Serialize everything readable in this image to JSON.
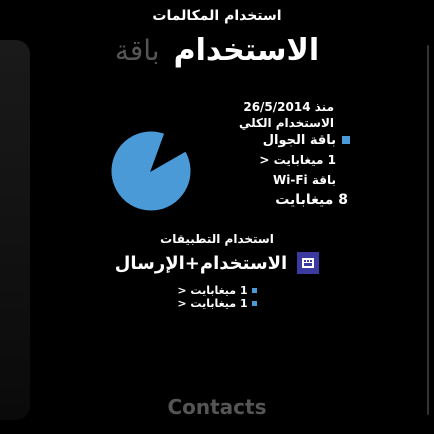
{
  "header": {
    "title": "استخدام المكالمات"
  },
  "heading": {
    "main": "الاستخدام",
    "ghost": "باقة"
  },
  "summary": {
    "date": "منذ 26/5/2014",
    "subtitle": "الاستخدام الكلي"
  },
  "legend": {
    "item1_label": "باقة الجوال",
    "item1_value": "1 ميغابايت <",
    "item2_label": "باقة Wi-Fi",
    "item2_value": "8 ميغابايت"
  },
  "chart_data": {
    "type": "pie",
    "series": [
      {
        "name": "باقة الجوال",
        "value": 1
      },
      {
        "name": "باقة Wi-Fi",
        "value": 8
      }
    ],
    "colors": [
      "#4a9ad8",
      "#000000"
    ]
  },
  "stats": {
    "title": "استخدام التطبيقات"
  },
  "usage": {
    "label": "الاستخدام+الإرسال"
  },
  "mini_legend": {
    "row1": "1 ميغابايت <",
    "row2": "1 ميغابايت <"
  },
  "bottom_peek": {
    "text": "Contacts"
  },
  "colors": {
    "accent": "#4a9ad8",
    "icon_bg": "#3a3aa0"
  }
}
